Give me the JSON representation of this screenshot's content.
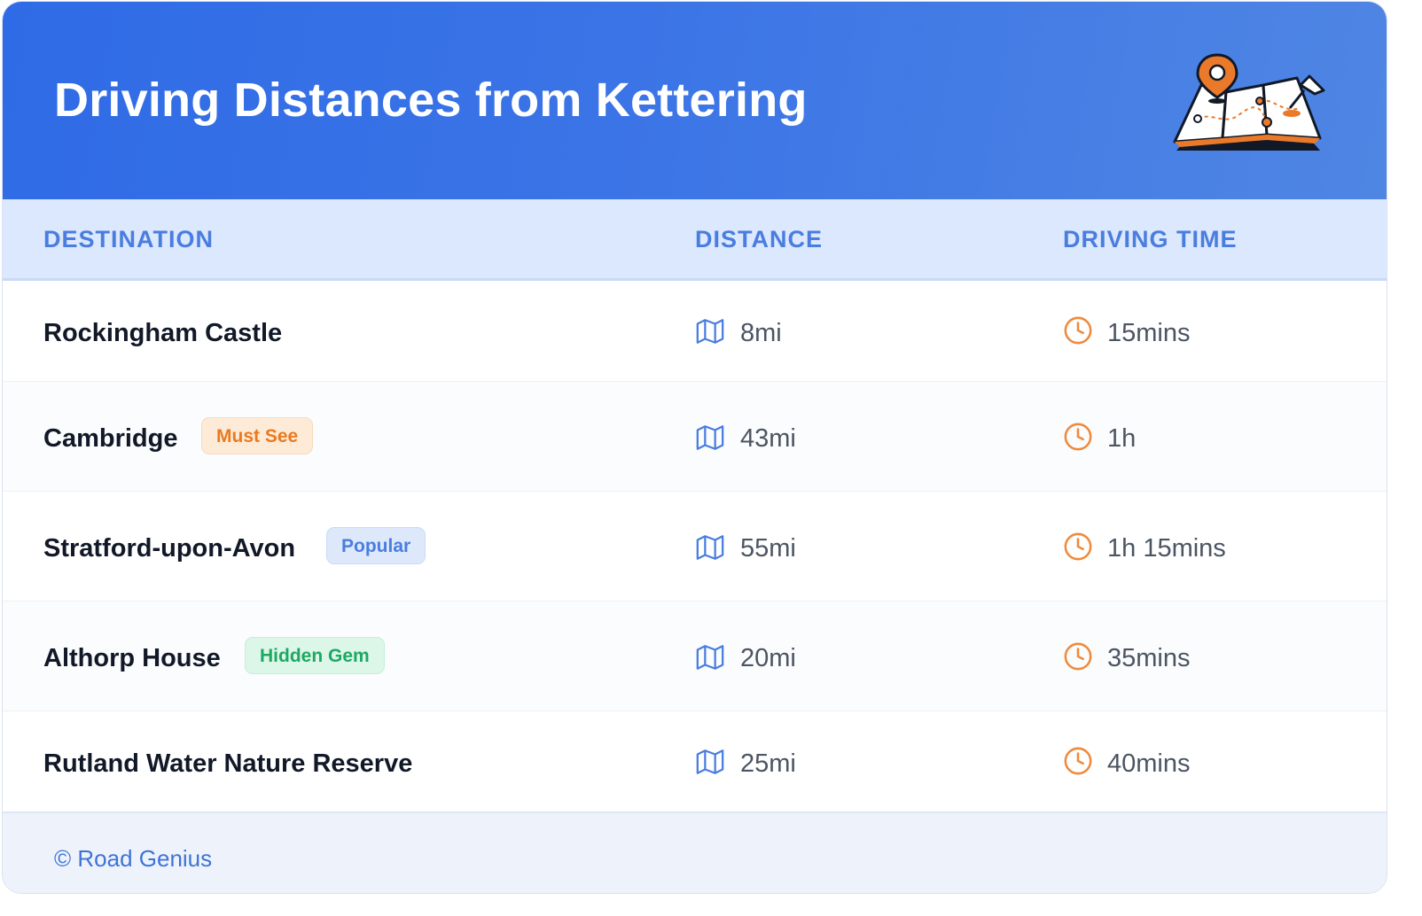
{
  "header": {
    "title": "Driving Distances from Kettering",
    "illustration_icon": "folded-map-with-pins-icon"
  },
  "table": {
    "columns": [
      "DESTINATION",
      "DISTANCE",
      "DRIVING TIME"
    ],
    "distance_icon": "map-icon",
    "time_icon": "clock-icon",
    "rows": [
      {
        "destination": "Rockingham Castle",
        "badge": "",
        "distance": "8mi",
        "time": "15mins"
      },
      {
        "destination": "Cambridge",
        "badge": "Must See",
        "distance": "43mi",
        "time": "1h"
      },
      {
        "destination": "Stratford-upon-Avon",
        "badge": "Popular",
        "distance": "55mi",
        "time": "1h 15mins"
      },
      {
        "destination": "Althorp House",
        "badge": "Hidden Gem",
        "distance": "20mi",
        "time": "35mins"
      },
      {
        "destination": "Rutland Water Nature Reserve",
        "badge": "",
        "distance": "25mi",
        "time": "40mins"
      }
    ]
  },
  "footer": {
    "text": "© Road Genius"
  },
  "colors": {
    "header_gradient_start": "#2f6be6",
    "header_gradient_end": "#4f86e4",
    "column_header_text": "#4a7de0",
    "distance_icon": "#4a7de0",
    "time_icon": "#ef8a3c",
    "badge_must_see": "#ea7a1f",
    "badge_popular": "#4a7de0",
    "badge_hidden_gem": "#1ea963"
  }
}
